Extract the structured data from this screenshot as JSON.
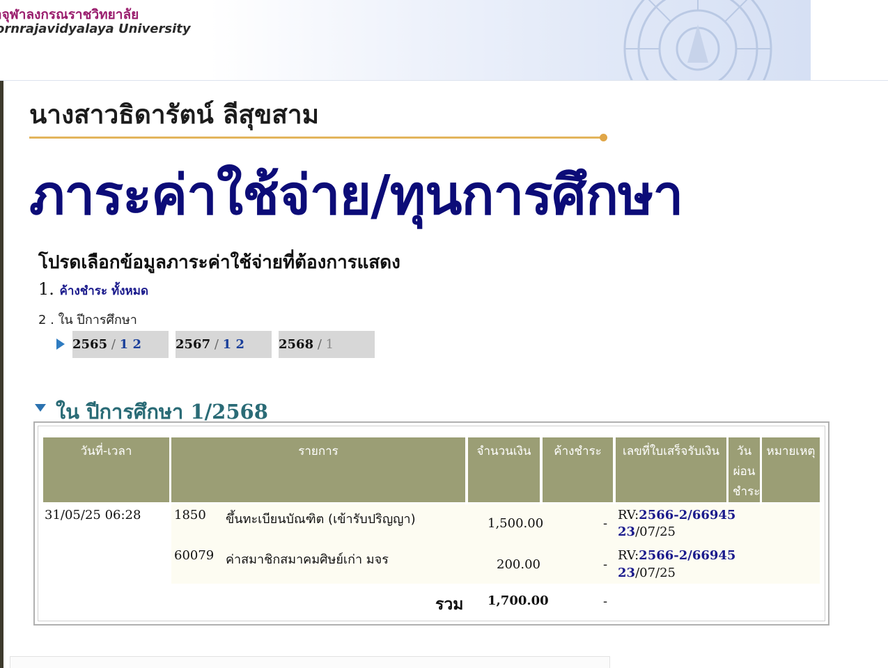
{
  "header": {
    "university_th": "าจุฬาลงกรณราชวิทยาลัย",
    "university_en": "ornrajavidyalaya University"
  },
  "student_name": "นางสาวธิดารัตน์ ลีสุขสาม",
  "page_title": "ภาระค่าใช้จ่าย/ทุนการศึกษา",
  "selection": {
    "prompt": "โปรดเลือกข้อมูลภาระค่าใช้จ่ายที่ต้องการแสดง",
    "option1_num": "1.",
    "option1_link": "ค้างชำระ ทั้งหมด",
    "option2": "2 . ใน ปีการศึกษา",
    "years": [
      {
        "year": "2565",
        "sep": " / ",
        "sems": [
          "1",
          "2"
        ],
        "active": true
      },
      {
        "year": "2567",
        "sep": " / ",
        "sems": [
          "1",
          "2"
        ],
        "active": false
      },
      {
        "year": "2568",
        "sep": " / ",
        "sems": [
          "1"
        ],
        "active": false
      }
    ]
  },
  "section": {
    "prefix": "ใน ปีการศึกษา",
    "term": "1/2568"
  },
  "table": {
    "headers": {
      "datetime": "วันที่-เวลา",
      "item": "รายการ",
      "amount": "จำนวนเงิน",
      "outstanding": "ค้างชำระ",
      "receipt": "เลขที่ใบเสร็จรับเงิน",
      "installment": "วัน ผ่อน ชำระ",
      "note": "หมายเหตุ"
    },
    "rows": [
      {
        "datetime": "31/05/25 06:28",
        "code": "1850",
        "desc": "ขึ้นทะเบียนบัณฑิต (เข้ารับปริญญา)",
        "amount": "1,500.00",
        "outstanding": "-",
        "receipt_prefix": "RV:",
        "receipt_no": "2566-2/66945",
        "receipt_day": "23",
        "receipt_rest": "/07/25"
      },
      {
        "datetime": "",
        "code": "60079",
        "desc": "ค่าสมาชิกสมาคมศิษย์เก่า มจร",
        "amount": "200.00",
        "outstanding": "-",
        "receipt_prefix": "RV:",
        "receipt_no": "2566-2/66945",
        "receipt_day": "23",
        "receipt_rest": "/07/25"
      }
    ],
    "total_label": "รวม",
    "total_amount": "1,700.00",
    "total_outstanding": "-"
  },
  "colors": {
    "title_navy": "#0c0c78",
    "header_olive": "#9b9e75",
    "section_teal": "#2a6b76",
    "gold_line": "#e3b55c",
    "link_blue": "#1a1a8c"
  }
}
